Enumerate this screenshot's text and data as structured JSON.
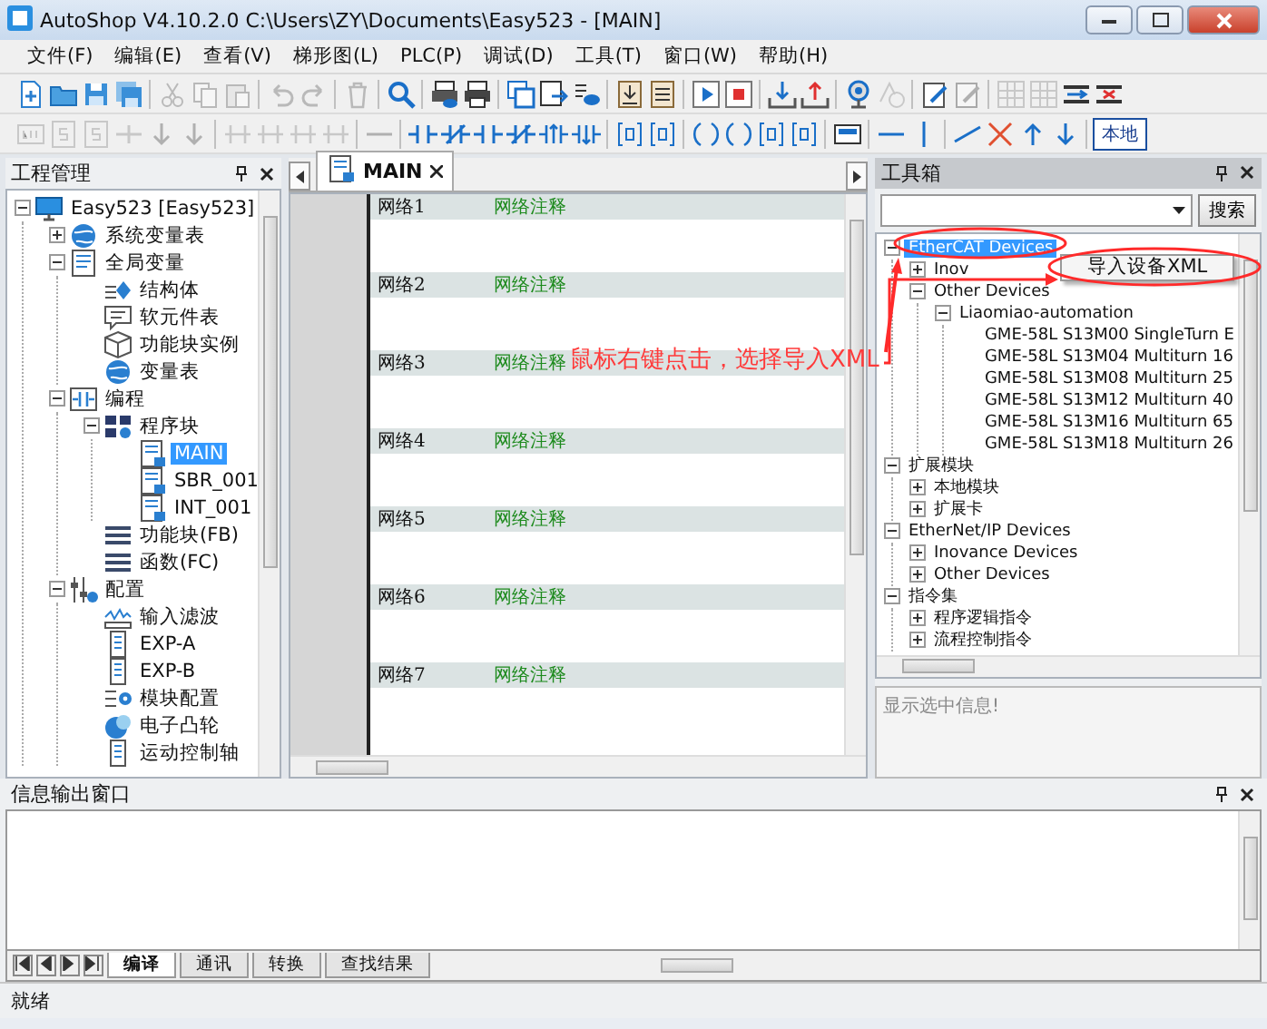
{
  "window": {
    "title": "AutoShop V4.10.2.0  C:\\Users\\ZY\\Documents\\Easy523 - [MAIN]"
  },
  "menu": [
    "文件(F)",
    "编辑(E)",
    "查看(V)",
    "梯形图(L)",
    "PLC(P)",
    "调试(D)",
    "工具(T)",
    "窗口(W)",
    "帮助(H)"
  ],
  "toolbar_rows": [
    [
      {
        "kind": "new-document",
        "disabled": false
      },
      {
        "kind": "folder",
        "disabled": false
      },
      {
        "kind": "floppy",
        "disabled": false
      },
      {
        "kind": "floppy-stack",
        "disabled": false
      },
      {
        "kind": "separator"
      },
      {
        "kind": "scissors",
        "disabled": true
      },
      {
        "kind": "copy",
        "disabled": true
      },
      {
        "kind": "clipboard",
        "disabled": true
      },
      {
        "kind": "separator"
      },
      {
        "kind": "undo-arrow",
        "disabled": true
      },
      {
        "kind": "redo-arrow",
        "disabled": true
      },
      {
        "kind": "separator"
      },
      {
        "kind": "trash",
        "disabled": true
      },
      {
        "kind": "separator"
      },
      {
        "kind": "magnifier",
        "disabled": false
      },
      {
        "kind": "separator"
      },
      {
        "kind": "printer-eye",
        "disabled": false
      },
      {
        "kind": "printer",
        "disabled": false
      },
      {
        "kind": "separator"
      },
      {
        "kind": "windows",
        "disabled": false
      },
      {
        "kind": "window-arrow",
        "disabled": false
      },
      {
        "kind": "list-eye",
        "disabled": false
      },
      {
        "kind": "separator"
      },
      {
        "kind": "document-down",
        "disabled": false
      },
      {
        "kind": "document-lines",
        "disabled": false
      },
      {
        "kind": "separator"
      },
      {
        "kind": "play",
        "disabled": false
      },
      {
        "kind": "stop",
        "disabled": false
      },
      {
        "kind": "separator"
      },
      {
        "kind": "tray-down",
        "disabled": false
      },
      {
        "kind": "tray-up",
        "disabled": false
      },
      {
        "kind": "separator"
      },
      {
        "kind": "webcam",
        "disabled": false
      },
      {
        "kind": "clock",
        "disabled": true
      },
      {
        "kind": "separator"
      },
      {
        "kind": "pen-document",
        "disabled": false
      },
      {
        "kind": "pen-document",
        "disabled": true
      },
      {
        "kind": "separator"
      },
      {
        "kind": "grid",
        "disabled": true
      },
      {
        "kind": "grid",
        "disabled": true
      },
      {
        "kind": "insert-row",
        "disabled": false
      },
      {
        "kind": "delete-row",
        "disabled": false
      }
    ],
    [
      {
        "kind": "lad-box",
        "disabled": true
      },
      {
        "kind": "s-box",
        "disabled": true
      },
      {
        "kind": "s-box",
        "disabled": true
      },
      {
        "kind": "tee",
        "disabled": true
      },
      {
        "kind": "down-arrow",
        "disabled": true
      },
      {
        "kind": "down-arrow",
        "disabled": true
      },
      {
        "kind": "separator"
      },
      {
        "kind": "branch",
        "disabled": true
      },
      {
        "kind": "branch",
        "disabled": true
      },
      {
        "kind": "branch",
        "disabled": true
      },
      {
        "kind": "branch",
        "disabled": true
      },
      {
        "kind": "separator"
      },
      {
        "kind": "hline",
        "disabled": true
      },
      {
        "kind": "separator"
      },
      {
        "kind": "contact",
        "disabled": false
      },
      {
        "kind": "contact-slash",
        "disabled": false
      },
      {
        "kind": "contact",
        "disabled": false
      },
      {
        "kind": "contact-slash",
        "disabled": false
      },
      {
        "kind": "contact-up",
        "disabled": false
      },
      {
        "kind": "contact-down",
        "disabled": false
      },
      {
        "kind": "separator"
      },
      {
        "kind": "bracket-box",
        "disabled": false
      },
      {
        "kind": "bracket-box",
        "disabled": false
      },
      {
        "kind": "separator"
      },
      {
        "kind": "coil",
        "disabled": false
      },
      {
        "kind": "coil",
        "disabled": false
      },
      {
        "kind": "bracket-box",
        "disabled": false
      },
      {
        "kind": "bracket-box",
        "disabled": false
      },
      {
        "kind": "separator"
      },
      {
        "kind": "card",
        "disabled": false
      },
      {
        "kind": "separator"
      },
      {
        "kind": "hline",
        "disabled": false
      },
      {
        "kind": "vline",
        "disabled": false
      },
      {
        "kind": "separator"
      },
      {
        "kind": "diagonal",
        "disabled": false
      },
      {
        "kind": "cross",
        "disabled": false
      },
      {
        "kind": "up-arrow",
        "disabled": false
      },
      {
        "kind": "down-arrow",
        "disabled": false
      },
      {
        "kind": "separator"
      }
    ]
  ],
  "toolbar_button": "本地",
  "project_panel": {
    "title": "工程管理",
    "tree": [
      {
        "label": "Easy523 [Easy523]",
        "kind": "monitor",
        "expanded": true,
        "selected": false,
        "children": [
          {
            "label": "系统变量表",
            "kind": "globe",
            "expanded": false,
            "selected": false
          },
          {
            "label": "全局变量",
            "kind": "list-doc",
            "expanded": true,
            "selected": false,
            "children": [
              {
                "label": "结构体",
                "kind": "struct",
                "selected": false
              },
              {
                "label": "软元件表",
                "kind": "speech",
                "selected": false
              },
              {
                "label": "功能块实例",
                "kind": "cube",
                "selected": false
              },
              {
                "label": "变量表",
                "kind": "globe",
                "selected": false
              }
            ]
          },
          {
            "label": "编程",
            "kind": "ladder",
            "expanded": true,
            "selected": false,
            "children": [
              {
                "label": "程序块",
                "kind": "blocks",
                "expanded": true,
                "selected": false,
                "children": [
                  {
                    "label": "MAIN",
                    "kind": "doc",
                    "selected": true
                  },
                  {
                    "label": "SBR_001",
                    "kind": "doc",
                    "selected": false
                  },
                  {
                    "label": "INT_001",
                    "kind": "doc",
                    "selected": false
                  }
                ]
              },
              {
                "label": "功能块(FB)",
                "kind": "bars",
                "selected": false
              },
              {
                "label": "函数(FC)",
                "kind": "bars",
                "selected": false
              }
            ]
          },
          {
            "label": "配置",
            "kind": "sliders",
            "expanded": true,
            "selected": false,
            "children": [
              {
                "label": "输入滤波",
                "kind": "wave",
                "selected": false
              },
              {
                "label": "EXP-A",
                "kind": "rack",
                "selected": false
              },
              {
                "label": "EXP-B",
                "kind": "rack",
                "selected": false
              },
              {
                "label": "模块配置",
                "kind": "gear-list",
                "selected": false
              },
              {
                "label": "电子凸轮",
                "kind": "cam",
                "selected": false
              },
              {
                "label": "运动控制轴",
                "kind": "rack",
                "selected": false
              }
            ]
          }
        ]
      }
    ]
  },
  "editor": {
    "tabs": [
      {
        "label": "MAIN",
        "selected": true
      }
    ],
    "networks": [
      {
        "label": "网络1",
        "comment": "网络注释"
      },
      {
        "label": "网络2",
        "comment": "网络注释"
      },
      {
        "label": "网络3",
        "comment": "网络注释"
      },
      {
        "label": "网络4",
        "comment": "网络注释"
      },
      {
        "label": "网络5",
        "comment": "网络注释"
      },
      {
        "label": "网络6",
        "comment": "网络注释"
      },
      {
        "label": "网络7",
        "comment": "网络注释"
      }
    ]
  },
  "toolbox": {
    "title": "工具箱",
    "search_button": "搜索",
    "tree": [
      {
        "label": "EtherCAT Devices",
        "expanded": true,
        "selected": true,
        "children": [
          {
            "label": "Inov",
            "expanded": false,
            "selected": false
          },
          {
            "label": "Other Devices",
            "expanded": true,
            "selected": false,
            "children": [
              {
                "label": "Liaomiao-automation",
                "expanded": true,
                "selected": false,
                "children": [
                  {
                    "label": "GME-58L S13M00 SingleTurn E",
                    "selected": false
                  },
                  {
                    "label": "GME-58L S13M04 Multiturn 16",
                    "selected": false
                  },
                  {
                    "label": "GME-58L S13M08 Multiturn 25",
                    "selected": false
                  },
                  {
                    "label": "GME-58L S13M12 Multiturn 40",
                    "selected": false
                  },
                  {
                    "label": "GME-58L S13M16 Multiturn 65",
                    "selected": false
                  },
                  {
                    "label": "GME-58L S13M18 Multiturn 26",
                    "selected": false
                  }
                ]
              }
            ]
          }
        ]
      },
      {
        "label": "扩展模块",
        "expanded": true,
        "selected": false,
        "children": [
          {
            "label": "本地模块",
            "expanded": false,
            "selected": false
          },
          {
            "label": "扩展卡",
            "expanded": false,
            "selected": false
          }
        ]
      },
      {
        "label": "EtherNet/IP Devices",
        "expanded": true,
        "selected": false,
        "children": [
          {
            "label": "Inovance Devices",
            "expanded": false,
            "selected": false
          },
          {
            "label": "Other Devices",
            "expanded": false,
            "selected": false
          }
        ]
      },
      {
        "label": "指令集",
        "expanded": true,
        "selected": false,
        "children": [
          {
            "label": "程序逻辑指令",
            "expanded": false,
            "selected": false
          },
          {
            "label": "流程控制指令",
            "expanded": false,
            "selected": false
          }
        ]
      }
    ],
    "info": "显示选中信息!"
  },
  "context_menu": {
    "items": [
      "导入设备XML"
    ]
  },
  "annotation": {
    "text": "鼠标右键点击，选择导入XML"
  },
  "output_window": {
    "title": "信息输出窗口",
    "tabs": [
      {
        "label": "编译",
        "selected": true
      },
      {
        "label": "通讯",
        "selected": false
      },
      {
        "label": "转换",
        "selected": false
      },
      {
        "label": "查找结果",
        "selected": false
      }
    ]
  },
  "status_bar": "就绪"
}
